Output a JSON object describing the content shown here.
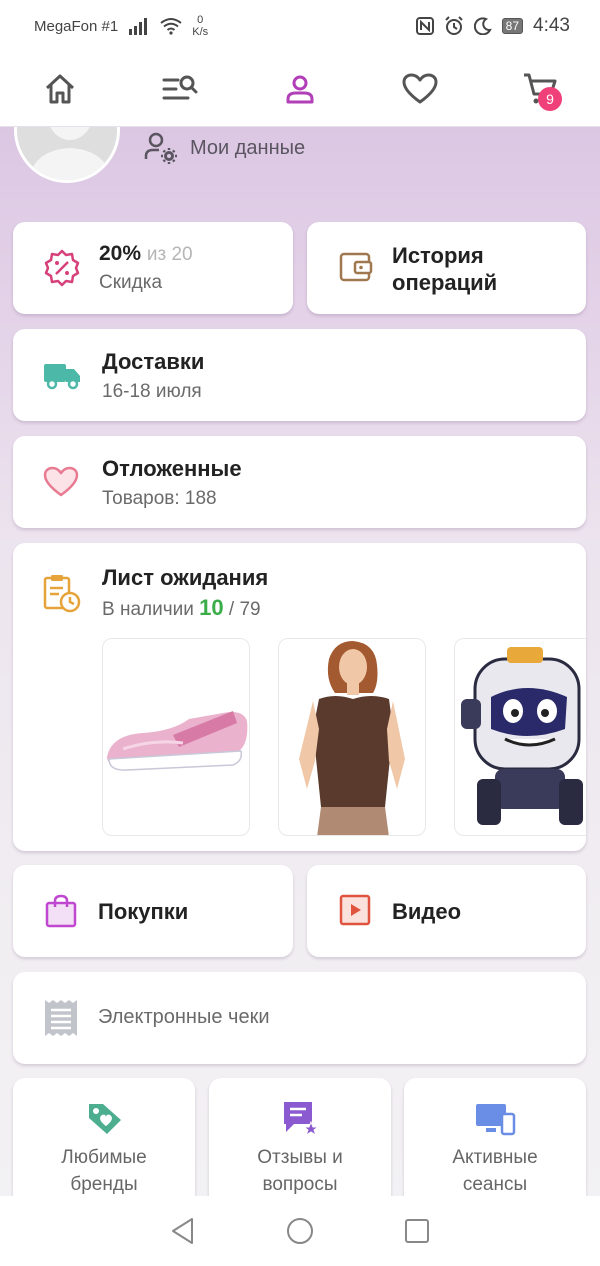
{
  "status_bar": {
    "carrier": "MegaFon #1",
    "net_speed_value": "0",
    "net_speed_unit": "K/s",
    "battery": "87",
    "time": "4:43"
  },
  "top_nav": {
    "cart_badge": "9",
    "active_color": "#b23fb8"
  },
  "profile": {
    "my_data_label": "Мои данные"
  },
  "discount": {
    "percent": "20%",
    "of_text": "из 20",
    "label": "Скидка"
  },
  "history": {
    "label_line1": "История",
    "label_line2": "операций"
  },
  "deliveries": {
    "title": "Доставки",
    "subtitle": "16-18 июля"
  },
  "favorites": {
    "title": "Отложенные",
    "subtitle": "Товаров: 188"
  },
  "waitlist": {
    "title": "Лист ожидания",
    "available_prefix": "В наличии",
    "available_count": "10",
    "total_text": "/ 79",
    "items": [
      "pink-shoe",
      "brown-blouse",
      "robot-toy"
    ]
  },
  "purchases": {
    "label": "Покупки"
  },
  "video": {
    "label": "Видео"
  },
  "receipts": {
    "label": "Электронные чеки"
  },
  "bottom_cards": [
    {
      "line1": "Любимые",
      "line2": "бренды"
    },
    {
      "line1": "Отзывы и",
      "line2": "вопросы"
    },
    {
      "line1": "Активные",
      "line2": "сеансы"
    }
  ]
}
